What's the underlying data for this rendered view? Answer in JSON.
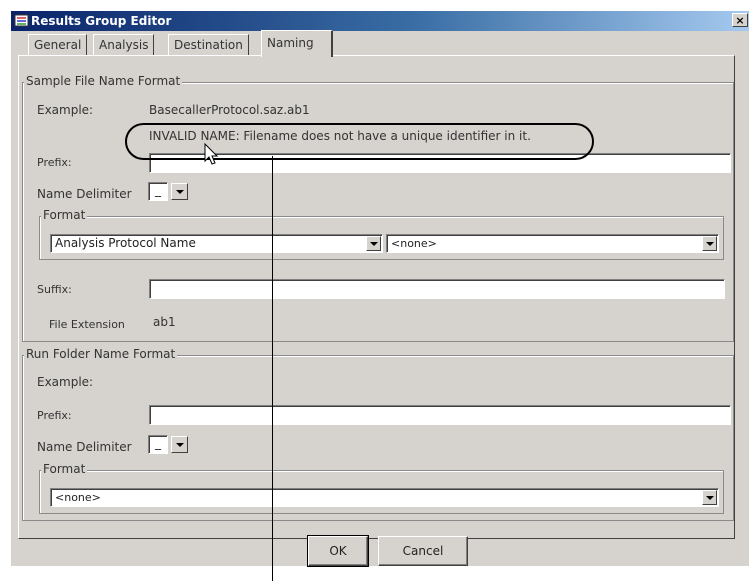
{
  "window": {
    "title": "Results Group Editor",
    "close_glyph": "×"
  },
  "tabs": [
    {
      "label": "General",
      "active": false
    },
    {
      "label": "Analysis",
      "active": false
    },
    {
      "label": "Destination",
      "active": false
    },
    {
      "label": "Naming",
      "active": true
    }
  ],
  "sample_file": {
    "group_label": "Sample File Name Format",
    "example_label": "Example:",
    "example_value": "BasecallerProtocol.saz.ab1",
    "error_message": "INVALID NAME:  Filename does not have a unique identifier in it.",
    "prefix_label": "Prefix:",
    "prefix_value": "",
    "delimiter_label": "Name Delimiter",
    "delimiter_value": "_",
    "format_label": "Format",
    "format_first_value": "Analysis Protocol Name",
    "format_second_value": "<none>",
    "suffix_label": "Suffix:",
    "suffix_value": "",
    "extension_label": "File Extension",
    "extension_value": "ab1"
  },
  "run_folder": {
    "group_label": "Run Folder Name Format",
    "example_label": "Example:",
    "prefix_label": "Prefix:",
    "prefix_value": "",
    "delimiter_label": "Name Delimiter",
    "delimiter_value": "_",
    "format_label": "Format",
    "format_value": "<none>"
  },
  "buttons": {
    "ok": "OK",
    "cancel": "Cancel"
  },
  "icons": {
    "app": "app-icon",
    "close": "close-icon",
    "dropdown": "chevron-down-icon",
    "cursor": "mouse-pointer-icon"
  },
  "colors": {
    "window_bg": "#d6d3ce",
    "title_start": "#0a246a",
    "title_end": "#a6caf0"
  }
}
